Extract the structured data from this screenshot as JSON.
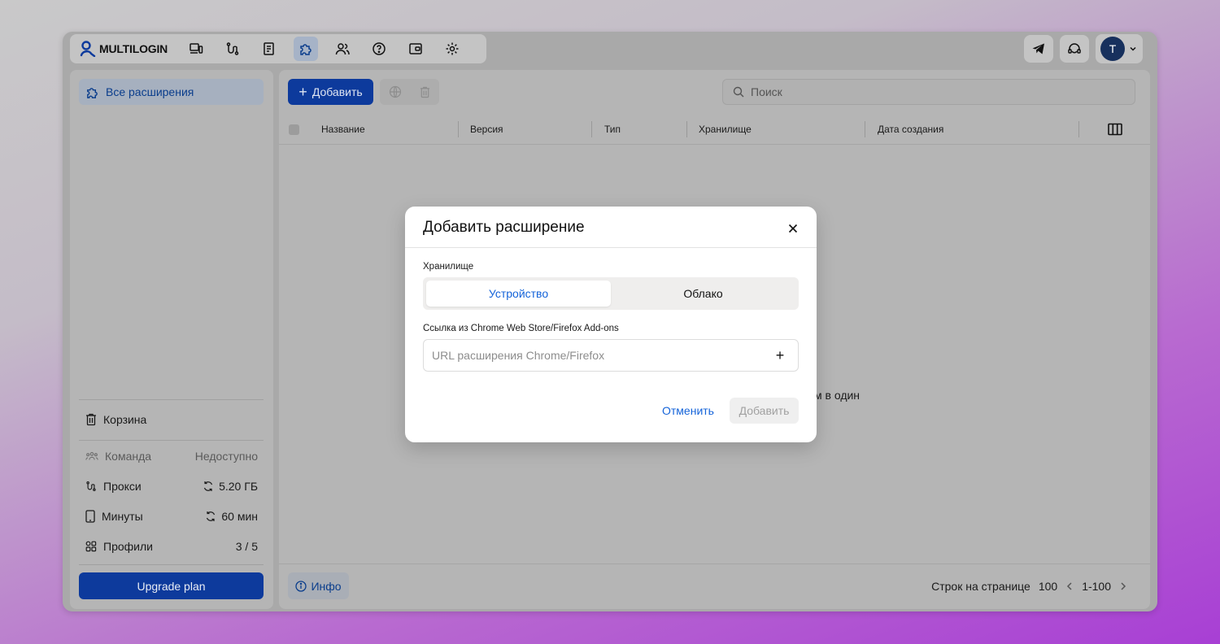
{
  "app": {
    "logo_text": "MULTILOGIN",
    "user_initial": "T"
  },
  "colors": {
    "accent": "#1463d9",
    "primary_button": "#0d3a9c",
    "background_gradient_end": "#a83fd4"
  },
  "topnav": {
    "icons": [
      "profiles-icon",
      "proxy-icon",
      "scripts-icon",
      "extensions-icon",
      "team-icon",
      "help-icon",
      "wallet-icon",
      "settings-icon"
    ],
    "active": "extensions-icon"
  },
  "sidebar": {
    "active_item": "Все расширения",
    "trash": "Корзина",
    "team": {
      "label": "Команда",
      "value": "Недоступно"
    },
    "proxy": {
      "label": "Прокси",
      "value": "5.20 ГБ"
    },
    "minutes": {
      "label": "Минуты",
      "value": "60 мин"
    },
    "profiles": {
      "label": "Профили",
      "value": "3 / 5"
    },
    "upgrade": "Upgrade plan"
  },
  "main": {
    "add_button": "Добавить",
    "search_placeholder": "Поиск",
    "columns": [
      "Название",
      "Версия",
      "Тип",
      "Хранилище",
      "Дата создания"
    ],
    "background_text": "м в один",
    "info_button": "Инфо",
    "pager": {
      "rows_label": "Строк на странице",
      "rows_value": "100",
      "range": "1-100"
    }
  },
  "modal": {
    "title": "Добавить расширение",
    "storage_label": "Хранилище",
    "storage_options": [
      "Устройство",
      "Облако"
    ],
    "storage_selected": "Устройство",
    "url_label": "Ссылка из Chrome Web Store/Firefox Add-ons",
    "url_placeholder": "URL расширения Chrome/Firefox",
    "url_value": "",
    "cancel": "Отменить",
    "submit": "Добавить"
  }
}
